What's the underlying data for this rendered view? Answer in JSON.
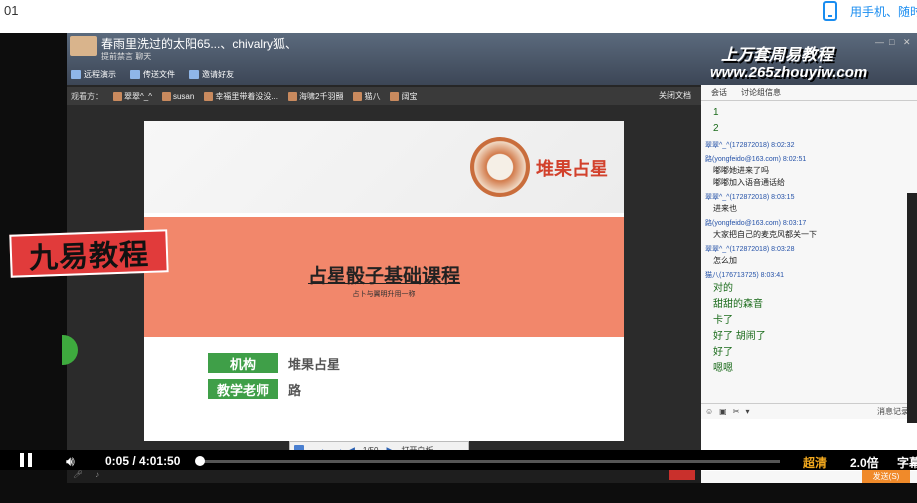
{
  "page": {
    "index": "01",
    "mobile_link": "用手机、随时"
  },
  "app": {
    "title": "春雨里洗过的太阳65...、chivalry狐、",
    "subtitle": "提前禁言 聊天",
    "tools": [
      "远程演示",
      "传送文件",
      "邀请好友"
    ],
    "watermark_title": "上万套周易教程",
    "watermark_url": "www.265zhouyiw.com",
    "viewers_label": "观看方：",
    "viewers": [
      "翠翠^_^",
      "susan",
      "幸福里带着没没...",
      "海啸2千羽翮",
      "猫八",
      "阔宝"
    ],
    "close_doc": "关闭文档"
  },
  "slide": {
    "brand": "堆果占星",
    "course_title": "占星骰子基础课程",
    "course_sub": "占卜与翼明升用一称",
    "org_label": "机构",
    "org_value": "堆果占星",
    "teacher_label": "教学老师",
    "teacher_value": "路",
    "page_counter": "1/50",
    "whiteboard": "打开白板"
  },
  "overlay_logo": "九易教程",
  "chat": {
    "tabs": [
      "会话",
      "讨论组信息"
    ],
    "messages": [
      {
        "sender": "",
        "text": "1",
        "big": true
      },
      {
        "sender": "",
        "text": "2",
        "big": true
      },
      {
        "sender": "翠翠^_^(172872018)  8:02:32",
        "text": ""
      },
      {
        "sender": "路(yongfeido@163.com)  8:02:51",
        "text": "嘟嘟她进来了吗"
      },
      {
        "sender": "",
        "text": "嘟嘟加入语音通话给"
      },
      {
        "sender": "翠翠^_^(172872018)  8:03:15",
        "text": "进来也"
      },
      {
        "sender": "路(yongfeido@163.com)  8:03:17",
        "text": "大家把自己的麦克风都关一下"
      },
      {
        "sender": "翠翠^_^(172872018)  8:03:28",
        "text": "怎么加"
      },
      {
        "sender": "猫八(176713725)  8:03:41",
        "text": "对的",
        "big": true
      },
      {
        "sender": "",
        "text": "甜甜的森音",
        "big": true
      },
      {
        "sender": "",
        "text": "卡了",
        "big": true
      },
      {
        "sender": "",
        "text": "好了 胡闹了",
        "big": true
      },
      {
        "sender": "",
        "text": "好了",
        "big": true
      },
      {
        "sender": "",
        "text": "嗯嗯",
        "big": true
      }
    ],
    "message_record": "消息记录",
    "send": "发送(S)"
  },
  "player": {
    "current": "0:05",
    "duration": "4:01:50",
    "progress": 0.0003,
    "quality": "超清",
    "speed": "2.0倍",
    "subtitle": "字幕"
  },
  "colors": {
    "accent": "#1a8df0",
    "slide_band": "#f2876b",
    "slide_green": "#3f9f48",
    "brand_red": "#d2412c"
  }
}
